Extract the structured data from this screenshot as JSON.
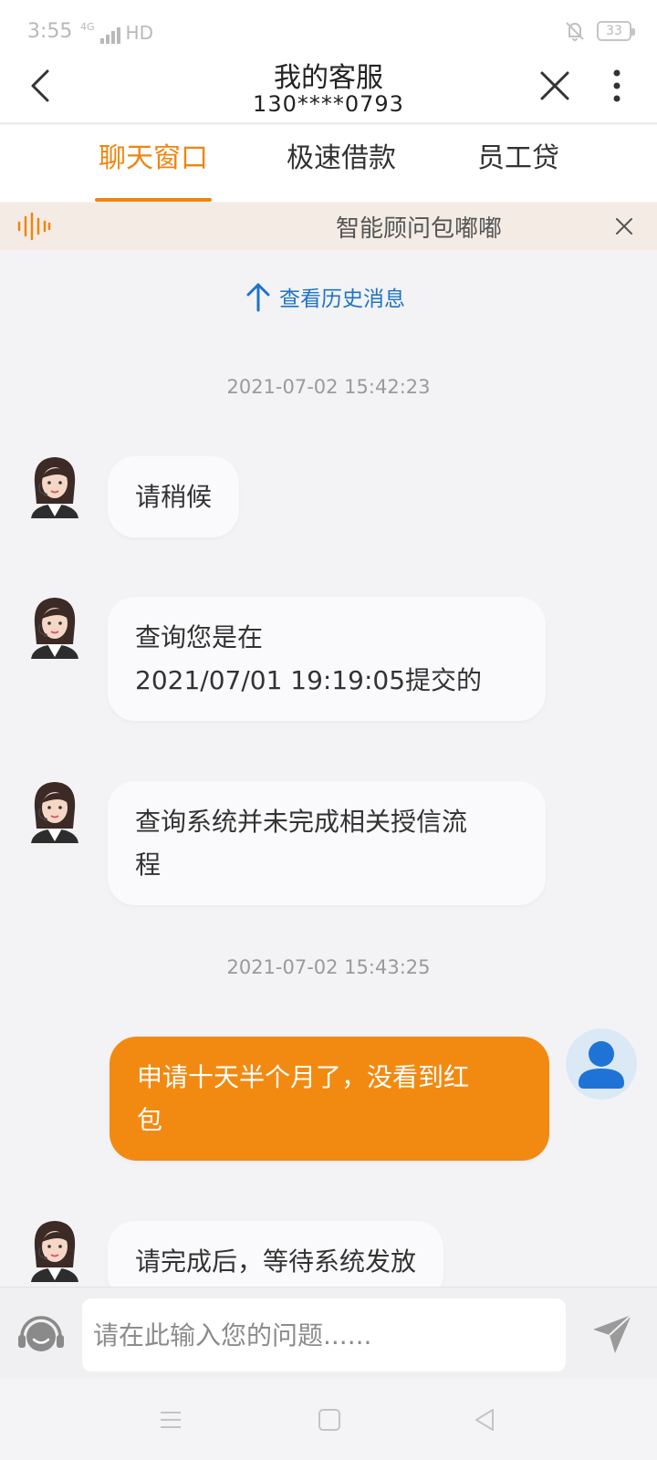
{
  "status_bar": {
    "time": "3:55",
    "network": "4G",
    "hd": "HD",
    "battery": "33"
  },
  "header": {
    "title": "我的客服",
    "subtitle": "130****0793"
  },
  "tabs": [
    {
      "label": "聊天窗口",
      "active": true
    },
    {
      "label": "极速借款",
      "active": false
    },
    {
      "label": "员工贷",
      "active": false
    }
  ],
  "notice": {
    "text": "智能顾问包嘟嘟"
  },
  "history_link": "查看历史消息",
  "messages": [
    {
      "type": "timestamp",
      "text": "2021-07-02 15:42:23"
    },
    {
      "type": "agent",
      "text": "请稍候"
    },
    {
      "type": "agent",
      "lines": [
        "查询您是在",
        "2021/07/01 19:19:05提交的"
      ]
    },
    {
      "type": "agent",
      "lines": [
        "查询系统并未完成相关授信流",
        "程"
      ]
    },
    {
      "type": "timestamp",
      "text": "2021-07-02 15:43:25"
    },
    {
      "type": "user",
      "lines": [
        "申请十天半个月了，没看到红",
        "包"
      ]
    },
    {
      "type": "agent",
      "text": "请完成后，等待系统发放"
    }
  ],
  "input": {
    "placeholder": "请在此输入您的问题......"
  },
  "colors": {
    "accent": "#f0850e",
    "user_bubble": "#f28a12",
    "link": "#1f73c9",
    "notice_bg": "#f3ebe4"
  },
  "icons": {
    "back": "chevron-left-icon",
    "close": "close-icon",
    "more": "more-vertical-icon",
    "wave": "voice-wave-icon",
    "history": "arrow-up-icon",
    "headset": "headset-icon",
    "send": "send-icon"
  }
}
